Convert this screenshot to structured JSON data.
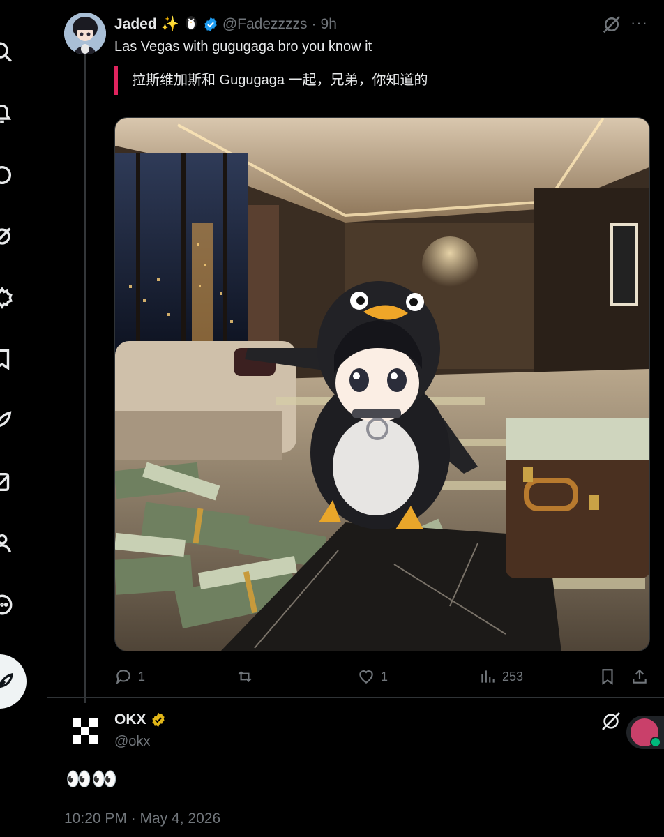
{
  "reply_tweet": {
    "display_name": "Jaded",
    "name_emoji": "✨",
    "handle": "@Fadezzzzs",
    "separator": "·",
    "time": "9h",
    "text": "Las Vegas with gugugaga bro you know it",
    "translation": "拉斯维加斯和 Gugugaga 一起，兄弟，你知道的",
    "more_label": "···",
    "actions": {
      "replies": "1",
      "retweets": "",
      "likes": "1",
      "views": "253"
    }
  },
  "main_tweet": {
    "display_name": "OKX",
    "handle": "@okx",
    "body": "👀👀",
    "timestamp": "10:20 PM · May 4, 2026"
  },
  "colors": {
    "background": "#000000",
    "text": "#e7e9ea",
    "muted": "#71767b",
    "verified_blue": "#1d9bf0",
    "verified_gold": "#e2b719",
    "translation_bar": "#e0245e"
  },
  "icons": {
    "rail": [
      "search-icon",
      "bell-icon",
      "chat-icon",
      "grok-icon",
      "communities-icon",
      "bookmark-icon",
      "feather-icon",
      "premium-icon",
      "profile-icon",
      "more-circle-icon"
    ],
    "actions": [
      "reply-icon",
      "retweet-icon",
      "like-icon",
      "views-icon",
      "bookmark-icon",
      "share-icon"
    ]
  }
}
